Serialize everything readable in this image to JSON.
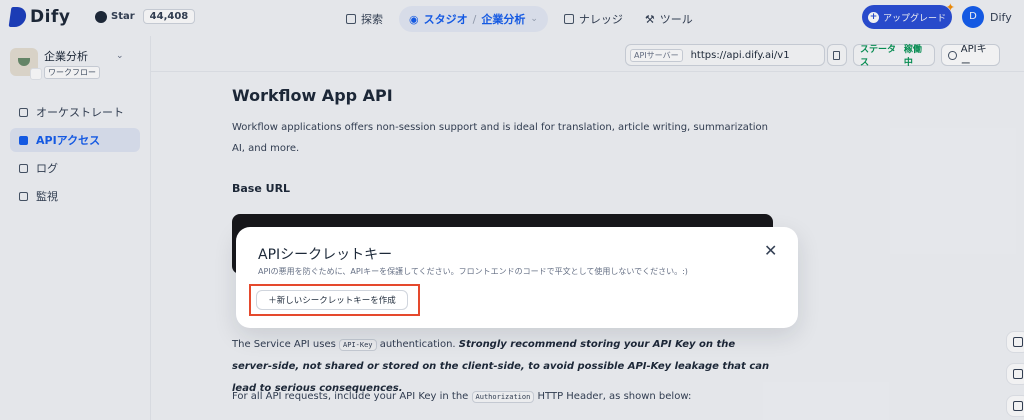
{
  "header": {
    "logo_text": "Dify",
    "github_label": "Star",
    "github_count": "44,408",
    "nav": {
      "explore": "探索",
      "studio": "スタジオ",
      "studio_sep": "/",
      "studio_app": "企業分析",
      "knowledge": "ナレッジ",
      "tools": "ツール"
    },
    "upgrade_label": "アップグレード",
    "user_initial": "D",
    "user_name": "Dify"
  },
  "sidebar": {
    "app_name": "企業分析",
    "app_type": "ワークフロー",
    "items": [
      {
        "label": "オーケストレート",
        "active": false
      },
      {
        "label": "APIアクセス",
        "active": true
      },
      {
        "label": "ログ",
        "active": false
      },
      {
        "label": "監視",
        "active": false
      }
    ]
  },
  "subheader": {
    "api_server_label": "APIサーバー",
    "api_url": "https://api.dify.ai/v1",
    "status_label": "ステータス",
    "status_value": "稼働中",
    "api_key_button": "APIキー"
  },
  "doc": {
    "title": "Workflow App API",
    "description": "Workflow applications offers non-session support and is ideal for translation, article writing, summarization AI, and more.",
    "base_url_heading": "Base URL",
    "auth_text_1": "The Service API uses",
    "auth_code": "API-Key",
    "auth_text_2": "authentication.",
    "auth_emphasis": "Strongly recommend storing your API Key on the server-side, not shared or stored on the client-side, to avoid possible API-Key leakage that can lead to serious consequences.",
    "header_text_1": "For all API requests, include your API Key in the",
    "header_code": "Authorization",
    "header_text_2": "HTTP Header, as shown below:"
  },
  "modal": {
    "title": "APIシークレットキー",
    "subtitle": "APIの悪用を防ぐために、APIキーを保護してください。フロントエンドのコードで平文として使用しないでください。:)",
    "close_glyph": "✕",
    "create_button": "＋新しいシークレットキーを作成"
  },
  "colors": {
    "accent": "#155eef",
    "upgrade": "#2a4ed6",
    "status_green": "#079455",
    "highlight": "#e5492d"
  }
}
